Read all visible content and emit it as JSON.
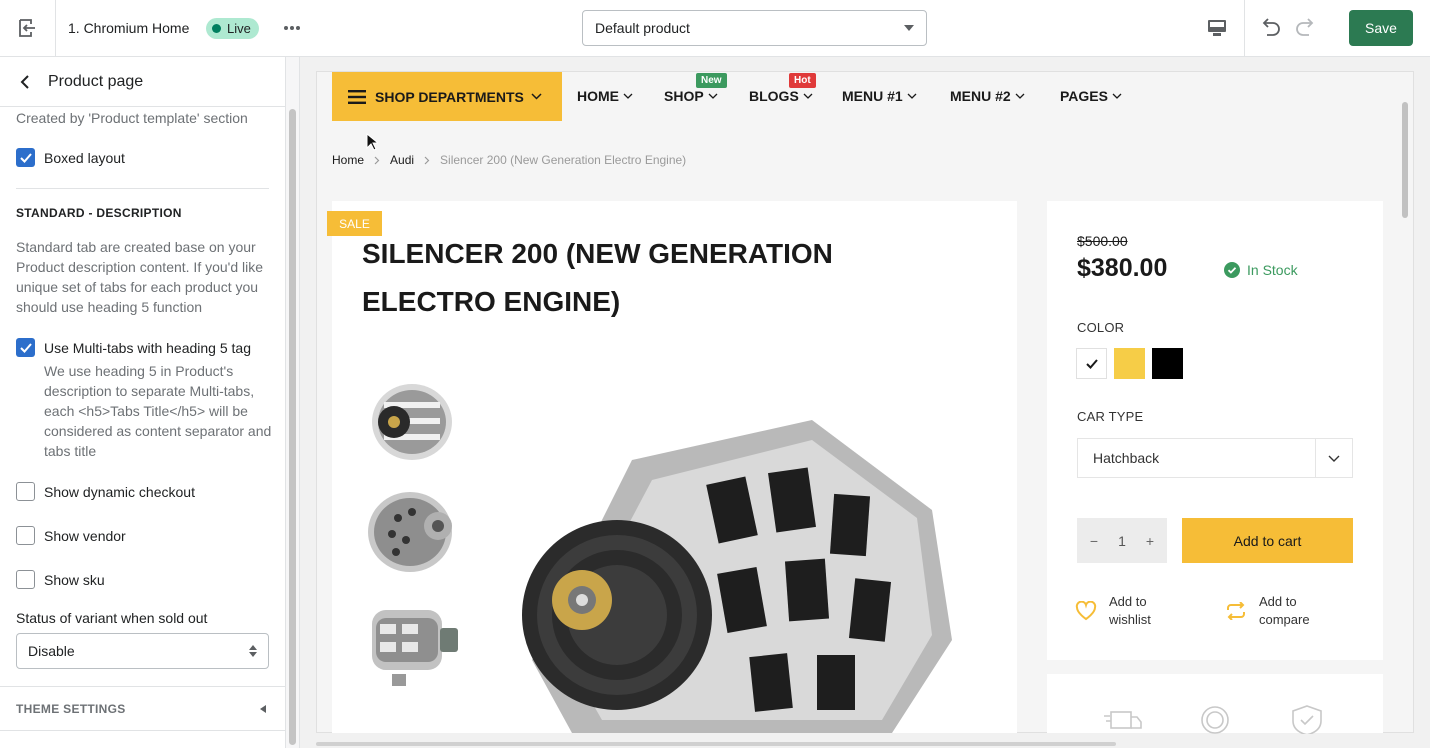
{
  "topbar": {
    "theme_name": "1. Chromium Home",
    "live_label": "Live",
    "template_select": "Default product",
    "save_label": "Save"
  },
  "sidebar": {
    "title": "Product page",
    "note": "Created by 'Product template' section",
    "boxed_layout": {
      "label": "Boxed layout",
      "checked": true
    },
    "section_title": "STANDARD - DESCRIPTION",
    "section_desc": "Standard tab are created base on your Product description content. If you'd like unique set of tabs for each product you should use heading 5 function",
    "multi_tabs": {
      "label": "Use Multi-tabs with heading 5 tag",
      "checked": true
    },
    "multi_tabs_desc": "We use heading 5 in Product's description to separate Multi-tabs, each <h5>Tabs Title</h5> will be considered as content separator and tabs title",
    "dynamic_checkout": {
      "label": "Show dynamic checkout",
      "checked": false
    },
    "show_vendor": {
      "label": "Show vendor",
      "checked": false
    },
    "show_sku": {
      "label": "Show sku",
      "checked": false
    },
    "sold_out_label": "Status of variant when sold out",
    "sold_out_value": "Disable",
    "theme_settings": "THEME SETTINGS"
  },
  "store": {
    "departments": "SHOP DEPARTMENTS",
    "nav": [
      {
        "label": "HOME"
      },
      {
        "label": "SHOP",
        "badge": "New",
        "badge_color": "#3c9a5f"
      },
      {
        "label": "BLOGS",
        "badge": "Hot",
        "badge_color": "#e03a3a"
      },
      {
        "label": "MENU #1"
      },
      {
        "label": "MENU #2"
      },
      {
        "label": "PAGES"
      }
    ],
    "breadcrumb": [
      "Home",
      "Audi",
      "Silencer 200 (New Generation Electro Engine)"
    ],
    "sale_badge": "SALE",
    "product_title": "SILENCER 200 (NEW GENERATION ELECTRO ENGINE)",
    "old_price": "$500.00",
    "price": "$380.00",
    "stock": "In Stock",
    "color_label": "COLOR",
    "colors": [
      "#ffffff",
      "#f6cd47",
      "#000000"
    ],
    "car_type_label": "CAR TYPE",
    "car_type_value": "Hatchback",
    "quantity": "1",
    "add_to_cart": "Add to cart",
    "wishlist": "Add to wishlist",
    "compare": "Add to compare"
  },
  "colors": {
    "accent": "#f6bd37",
    "save": "#2c7a52",
    "checkbox": "#2c6ecb",
    "stock": "#3c9a5f"
  }
}
